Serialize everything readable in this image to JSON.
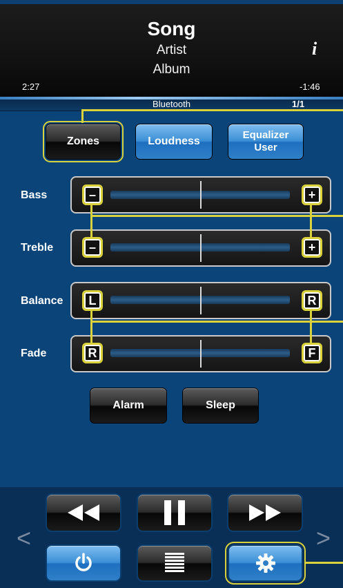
{
  "header": {
    "song": "Song",
    "artist": "Artist",
    "album": "Album",
    "info_icon": "i",
    "elapsed": "2:27",
    "remaining": "-1:46",
    "source": "Bluetooth",
    "track": "1/1"
  },
  "toggles": {
    "zones": "Zones",
    "loudness": "Loudness",
    "equalizer_line1": "Equalizer",
    "equalizer_line2": "User"
  },
  "sliders": [
    {
      "label": "Bass",
      "left": "–",
      "right": "+",
      "value": 0
    },
    {
      "label": "Treble",
      "left": "–",
      "right": "+",
      "value": 0
    },
    {
      "label": "Balance",
      "left": "L",
      "right": "R",
      "value": 0
    },
    {
      "label": "Fade",
      "left": "R",
      "right": "F",
      "value": 0
    }
  ],
  "actions": {
    "alarm": "Alarm",
    "sleep": "Sleep"
  },
  "transport": {
    "prev_icon": "rewind-icon",
    "pause_icon": "pause-icon",
    "next_icon": "fast-forward-icon"
  },
  "footer": {
    "left_chevron": "<",
    "right_chevron": ">",
    "power_icon": "power-icon",
    "menu_icon": "list-icon",
    "settings_icon": "gear-icon"
  },
  "colors": {
    "background": "#0b4478",
    "highlight": "#d9d23b",
    "accent_blue": "#3b8fd6"
  }
}
